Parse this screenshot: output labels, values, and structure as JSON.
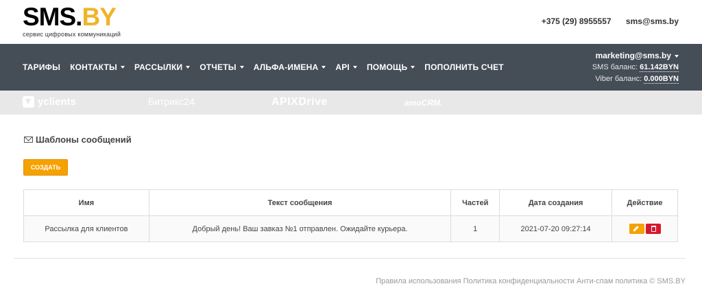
{
  "header": {
    "logo_main": "SMS.",
    "logo_accent": "BY",
    "logo_sub": "сервис цифровых коммуникаций",
    "phone": "+375 (29) 8955557",
    "email": "sms@sms.by"
  },
  "nav": {
    "items": [
      {
        "label": "ТАРИФЫ",
        "dropdown": false
      },
      {
        "label": "КОНТАКТЫ",
        "dropdown": true
      },
      {
        "label": "РАССЫЛКИ",
        "dropdown": true
      },
      {
        "label": "ОТЧЕТЫ",
        "dropdown": true
      },
      {
        "label": "АЛЬФА-ИМЕНА",
        "dropdown": true
      },
      {
        "label": "API",
        "dropdown": true
      },
      {
        "label": "ПОМОЩЬ",
        "dropdown": true
      },
      {
        "label": "ПОПОЛНИТЬ СЧЕТ",
        "dropdown": false
      }
    ]
  },
  "account": {
    "email": "marketing@sms.by",
    "sms_label": "SMS баланс:",
    "sms_value": "61.142BYN",
    "viber_label": "Viber баланс:",
    "viber_value": "0.000BYN"
  },
  "partners": {
    "yclients": "yclients",
    "bitrix": "Битрикс24",
    "apix": "APIXDrive",
    "amocrm": "amoCRM."
  },
  "page": {
    "title": "Шаблоны сообщений",
    "create_label": "СОЗДАТЬ"
  },
  "table": {
    "headers": [
      "Имя",
      "Текст сообщения",
      "Частей",
      "Дата создания",
      "Действие"
    ],
    "rows": [
      {
        "name": "Рассылка для клиентов",
        "text": "Добрый день! Ваш завказ №1 отправлен. Ожидайте курьера.",
        "parts": "1",
        "date": "2021-07-20 09:27:14"
      }
    ]
  },
  "footer": {
    "rules": "Правила использования",
    "privacy": "Политика конфиденциальности",
    "antispam": "Анти-спам политика",
    "copyright": "© SMS.BY"
  },
  "colors": {
    "nav_bg": "#454d57",
    "accent": "#f5a100",
    "danger": "#d5182d",
    "logo_accent": "#f0b429"
  }
}
